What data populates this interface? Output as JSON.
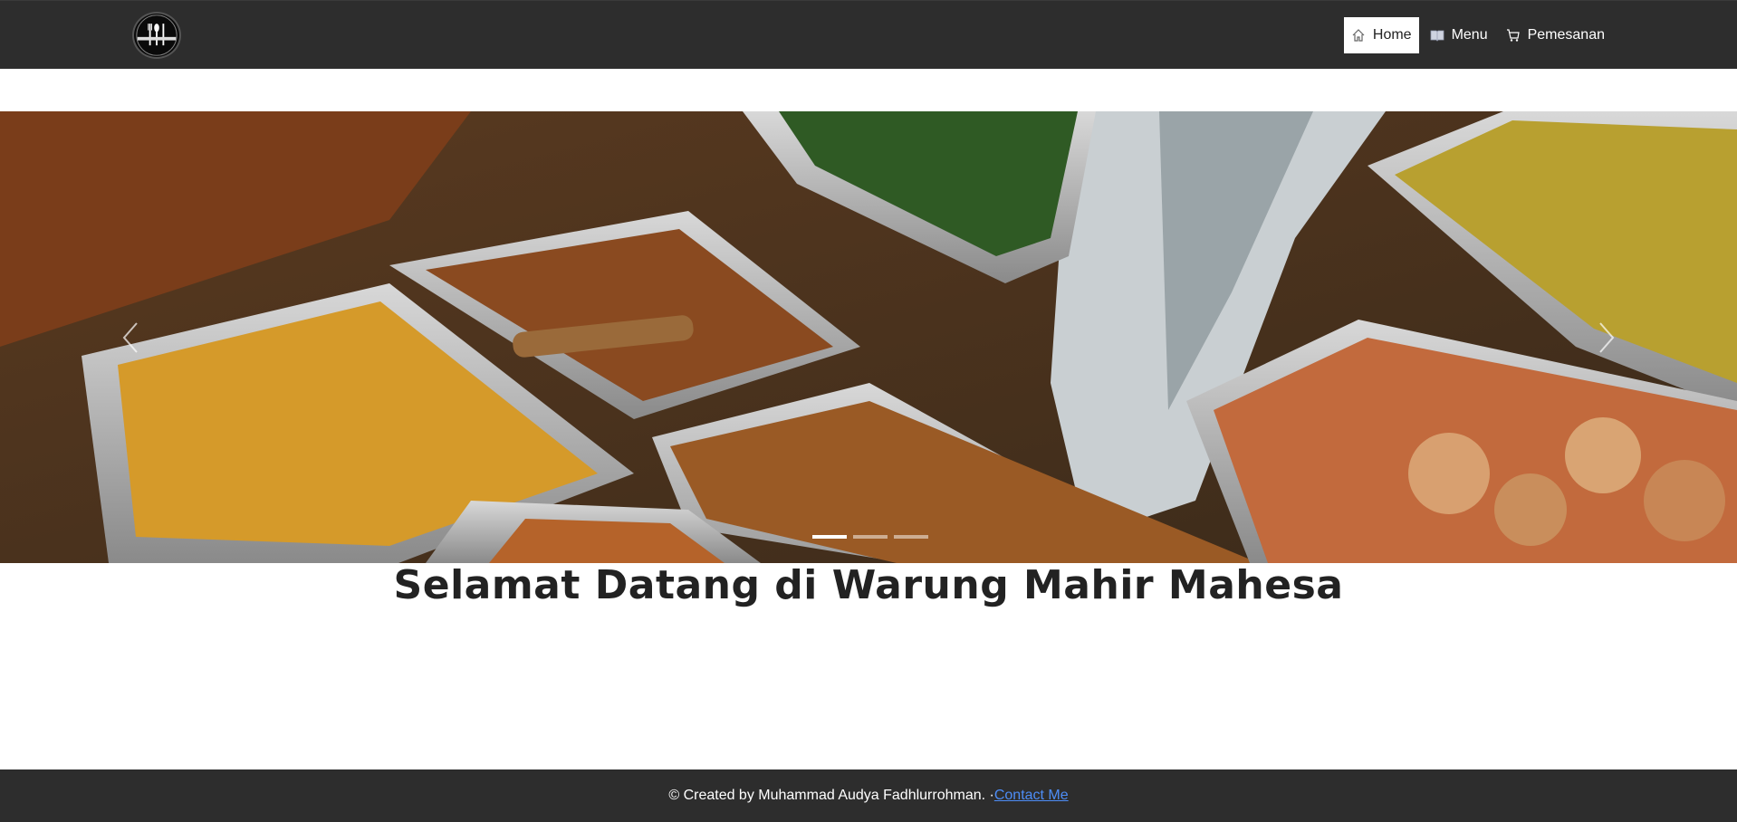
{
  "navbar": {
    "logo_icon": "restaurant-cutlery-logo",
    "items": [
      {
        "label": "Home",
        "icon": "home-icon",
        "active": true
      },
      {
        "label": "Menu",
        "icon": "book-icon",
        "active": false
      },
      {
        "label": "Pemesanan",
        "icon": "cart-icon",
        "active": false
      }
    ]
  },
  "carousel": {
    "prev_icon": "chevron-left-icon",
    "next_icon": "chevron-right-icon",
    "slide_count": 3,
    "active_slide": 1
  },
  "main": {
    "welcome_title": "Selamat Datang di Warung Mahir Mahesa"
  },
  "footer": {
    "credit_text": "© Created by Muhammad Audya Fadhlurrohman. · ",
    "contact_link": "Contact Me"
  },
  "colors": {
    "navbar_bg": "#2d2d2d",
    "footer_bg": "#2d2d2d",
    "link": "#4d8df6",
    "text_dark": "#222222"
  }
}
